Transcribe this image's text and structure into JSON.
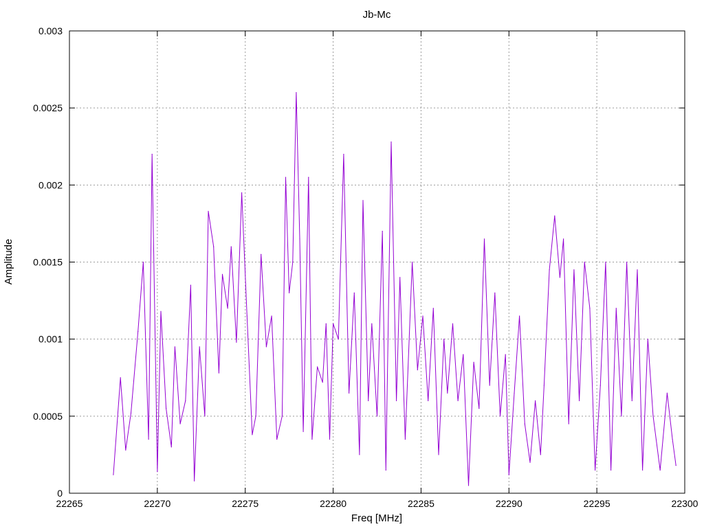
{
  "chart_data": {
    "type": "line",
    "title": "Jb-Mc",
    "xlabel": "Freq [MHz]",
    "ylabel": "Amplitude",
    "xlim": [
      22265,
      22300
    ],
    "ylim": [
      0,
      0.003
    ],
    "xticks": [
      22265,
      22270,
      22275,
      22280,
      22285,
      22290,
      22295,
      22300
    ],
    "yticks": [
      0,
      0.0005,
      0.001,
      0.0015,
      0.002,
      0.0025,
      0.003
    ],
    "xtick_labels": [
      "22265",
      "22270",
      "22275",
      "22280",
      "22285",
      "22290",
      "22295",
      "22300"
    ],
    "ytick_labels": [
      "0",
      "0.0005",
      "0.001",
      "0.0015",
      "0.002",
      "0.0025",
      "0.003"
    ],
    "grid": true,
    "legend": "none",
    "series": [
      {
        "color": "#9400d3",
        "x": [
          22267.5,
          22267.9,
          22268.2,
          22268.5,
          22268.9,
          22269.2,
          22269.5,
          22269.7,
          22270.0,
          22270.2,
          22270.5,
          22270.8,
          22271.0,
          22271.3,
          22271.6,
          22271.9,
          22272.1,
          22272.4,
          22272.7,
          22272.9,
          22273.2,
          22273.5,
          22273.7,
          22274.0,
          22274.2,
          22274.5,
          22274.8,
          22275.1,
          22275.4,
          22275.6,
          22275.9,
          22276.2,
          22276.5,
          22276.8,
          22277.1,
          22277.3,
          22277.5,
          22277.7,
          22277.9,
          22278.1,
          22278.3,
          22278.6,
          22278.8,
          22279.1,
          22279.4,
          22279.6,
          22279.8,
          22280.0,
          22280.3,
          22280.6,
          22280.9,
          22281.2,
          22281.5,
          22281.7,
          22282.0,
          22282.2,
          22282.5,
          22282.8,
          22283.0,
          22283.3,
          22283.6,
          22283.8,
          22284.1,
          22284.5,
          22284.8,
          22285.1,
          22285.4,
          22285.7,
          22286.0,
          22286.3,
          22286.5,
          22286.8,
          22287.1,
          22287.4,
          22287.7,
          22288.0,
          22288.3,
          22288.6,
          22288.9,
          22289.2,
          22289.5,
          22289.8,
          22290.0,
          22290.3,
          22290.6,
          22290.9,
          22291.2,
          22291.5,
          22291.8,
          22292.0,
          22292.3,
          22292.6,
          22292.9,
          22293.1,
          22293.4,
          22293.7,
          22294.0,
          22294.3,
          22294.6,
          22294.9,
          22295.2,
          22295.5,
          22295.8,
          22296.1,
          22296.4,
          22296.7,
          22297.0,
          22297.3,
          22297.6,
          22297.9,
          22298.2,
          22298.6,
          22299.0,
          22299.3,
          22299.5
        ],
        "values": [
          0.00012,
          0.00075,
          0.00028,
          0.00052,
          0.00105,
          0.0015,
          0.00035,
          0.0022,
          0.00014,
          0.00118,
          0.00055,
          0.0003,
          0.00095,
          0.00045,
          0.0006,
          0.00135,
          8e-05,
          0.00095,
          0.0005,
          0.00183,
          0.0016,
          0.00078,
          0.00142,
          0.0012,
          0.0016,
          0.00098,
          0.00195,
          0.00115,
          0.00038,
          0.0005,
          0.00155,
          0.00095,
          0.00115,
          0.00035,
          0.0005,
          0.00205,
          0.0013,
          0.0015,
          0.0026,
          0.00165,
          0.0004,
          0.00205,
          0.00035,
          0.00082,
          0.00072,
          0.0011,
          0.00035,
          0.0011,
          0.001,
          0.0022,
          0.00065,
          0.0013,
          0.00025,
          0.0019,
          0.0006,
          0.0011,
          0.0005,
          0.0017,
          0.00015,
          0.00228,
          0.0006,
          0.0014,
          0.00035,
          0.0015,
          0.0008,
          0.00115,
          0.0006,
          0.0012,
          0.00025,
          0.001,
          0.00065,
          0.0011,
          0.0006,
          0.0009,
          5e-05,
          0.00085,
          0.00055,
          0.00165,
          0.0007,
          0.0013,
          0.0005,
          0.0009,
          0.00012,
          0.00065,
          0.00115,
          0.00045,
          0.0002,
          0.0006,
          0.00025,
          0.0007,
          0.00145,
          0.0018,
          0.0014,
          0.00165,
          0.00045,
          0.00145,
          0.0006,
          0.0015,
          0.0012,
          0.00015,
          0.0007,
          0.0015,
          0.00015,
          0.0012,
          0.0005,
          0.0015,
          0.0006,
          0.00145,
          0.00015,
          0.001,
          0.0005,
          0.00015,
          0.00065,
          0.00035,
          0.00018
        ]
      }
    ]
  }
}
